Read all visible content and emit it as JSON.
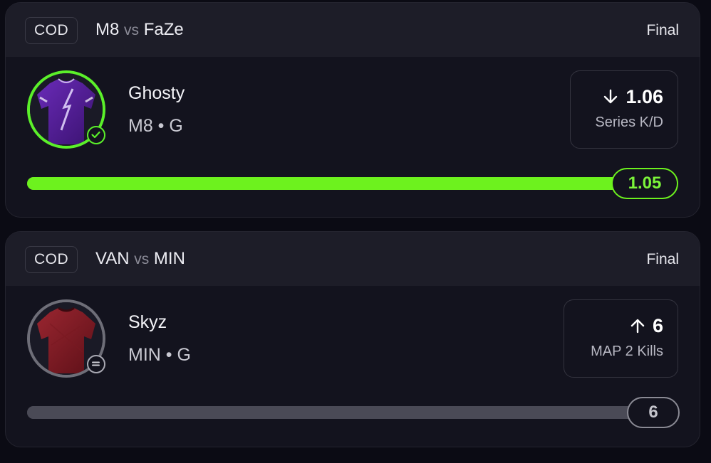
{
  "cards": [
    {
      "league_badge": "COD",
      "team_a": "M8",
      "vs": "vs",
      "team_b": "FaZe",
      "status": "Final",
      "player": {
        "name": "Ghosty",
        "meta": "M8 • G",
        "avatar": "purple-jersey",
        "status_icon": "check-circle-icon"
      },
      "stat": {
        "direction": "down",
        "direction_icon": "arrow-down-icon",
        "value": "1.06",
        "label": "Series K/D"
      },
      "progress": {
        "result": "1.05",
        "fill_fraction": 1.0,
        "color": "#6df21e"
      }
    },
    {
      "league_badge": "COD",
      "team_a": "VAN",
      "vs": "vs",
      "team_b": "MIN",
      "status": "Final",
      "player": {
        "name": "Skyz",
        "meta": "MIN • G",
        "avatar": "red-jersey",
        "status_icon": "equals-circle-icon"
      },
      "stat": {
        "direction": "up",
        "direction_icon": "arrow-up-icon",
        "value": "6",
        "label": "MAP 2 Kills"
      },
      "progress": {
        "result": "6",
        "fill_fraction": 1.0,
        "color": "#4a4a56"
      }
    }
  ]
}
